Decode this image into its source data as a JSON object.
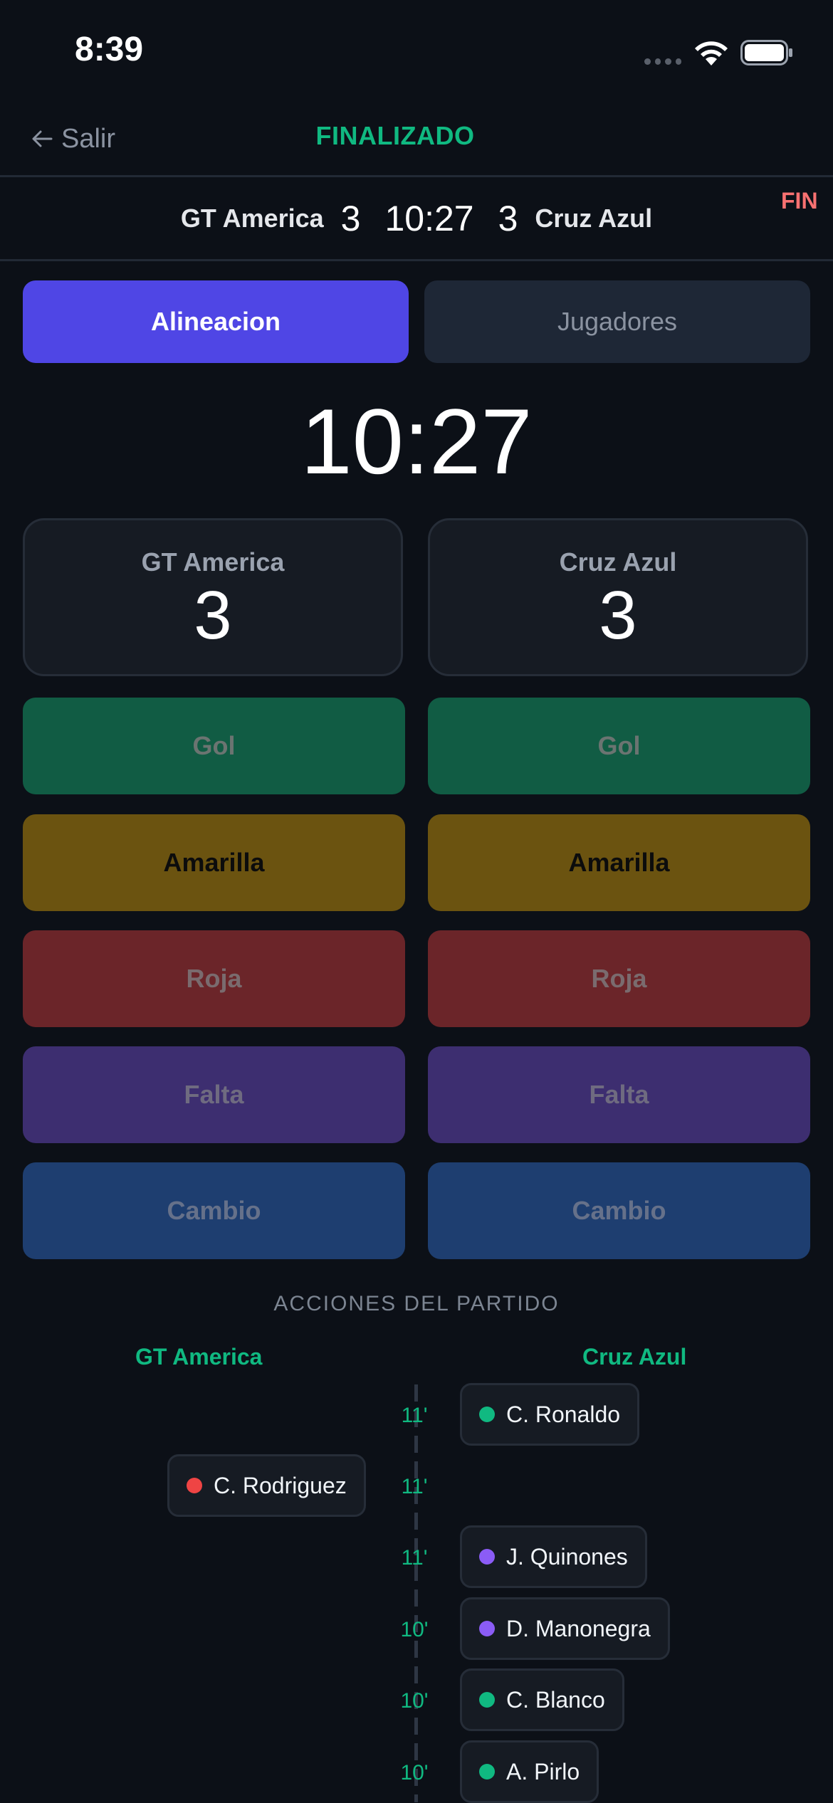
{
  "status_bar": {
    "time": "8:39"
  },
  "nav": {
    "back_label": "Salir",
    "state": "FINALIZADO"
  },
  "scoreboard": {
    "home_team": "GT America",
    "home_score": "3",
    "time": "10:27",
    "away_score": "3",
    "away_team": "Cruz Azul",
    "status_badge": "FIN"
  },
  "tabs": {
    "active": "Alineacion",
    "inactive": "Jugadores"
  },
  "clock": "10:27",
  "teams": {
    "home": {
      "name": "GT America",
      "score": "3"
    },
    "away": {
      "name": "Cruz Azul",
      "score": "3"
    }
  },
  "actions": {
    "gol": "Gol",
    "amarilla": "Amarilla",
    "roja": "Roja",
    "falta": "Falta",
    "cambio": "Cambio"
  },
  "colors": {
    "accent": "#4f46e5",
    "green": "#10b981",
    "red": "#ef4444",
    "purple": "#8b5cf6",
    "gol": "#115c44",
    "amarilla": "#6b5310",
    "roja": "#6b2529",
    "falta": "#3d2e70",
    "cambio": "#1e3e70"
  },
  "events_section": {
    "title": "ACCIONES DEL PARTIDO",
    "home_header": "GT America",
    "away_header": "Cruz Azul",
    "events": [
      {
        "minute": "11'",
        "side": "away",
        "player": "C. Ronaldo",
        "color": "#10b981"
      },
      {
        "minute": "11'",
        "side": "home",
        "player": "C. Rodriguez",
        "color": "#ef4444"
      },
      {
        "minute": "11'",
        "side": "away",
        "player": "J. Quinones",
        "color": "#8b5cf6"
      },
      {
        "minute": "10'",
        "side": "away",
        "player": "D. Manonegra",
        "color": "#8b5cf6"
      },
      {
        "minute": "10'",
        "side": "away",
        "player": "C. Blanco",
        "color": "#10b981"
      },
      {
        "minute": "10'",
        "side": "away",
        "player": "A. Pirlo",
        "color": "#10b981"
      }
    ]
  }
}
